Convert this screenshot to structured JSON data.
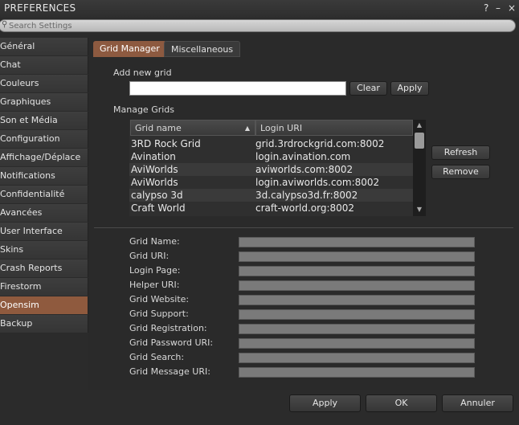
{
  "window": {
    "title": "PREFERENCES",
    "help_icon": "?",
    "minimize_icon": "–",
    "close_icon": "×"
  },
  "search": {
    "placeholder": "Search Settings"
  },
  "sidebar": {
    "items": [
      {
        "label": "Général"
      },
      {
        "label": "Chat"
      },
      {
        "label": "Couleurs"
      },
      {
        "label": "Graphiques"
      },
      {
        "label": "Son et Média"
      },
      {
        "label": "Configuration"
      },
      {
        "label": "Affichage/Déplace"
      },
      {
        "label": "Notifications"
      },
      {
        "label": "Confidentialité"
      },
      {
        "label": "Avancées"
      },
      {
        "label": "User Interface"
      },
      {
        "label": "Skins"
      },
      {
        "label": "Crash Reports"
      },
      {
        "label": "Firestorm"
      },
      {
        "label": "Opensim"
      },
      {
        "label": "Backup"
      }
    ],
    "active": "Opensim"
  },
  "tabs": [
    {
      "label": "Grid Manager"
    },
    {
      "label": "Miscellaneous"
    }
  ],
  "add_grid": {
    "label": "Add new grid",
    "value": "",
    "clear_label": "Clear",
    "apply_label": "Apply"
  },
  "manage": {
    "label": "Manage Grids",
    "columns": [
      "Grid name",
      "Login URI"
    ],
    "rows": [
      {
        "name": "3RD Rock Grid",
        "uri": "grid.3rdrockgrid.com:8002"
      },
      {
        "name": "Avination",
        "uri": "login.avination.com"
      },
      {
        "name": "AviWorlds",
        "uri": "aviworlds.com:8002"
      },
      {
        "name": "AviWorlds",
        "uri": "login.aviworlds.com:8002"
      },
      {
        "name": "calypso 3d",
        "uri": "3d.calypso3d.fr:8002"
      },
      {
        "name": "Craft World",
        "uri": "craft-world.org:8002"
      }
    ],
    "refresh_label": "Refresh",
    "remove_label": "Remove"
  },
  "details": [
    {
      "label": "Grid Name:"
    },
    {
      "label": "Grid URI:"
    },
    {
      "label": "Login Page:"
    },
    {
      "label": "Helper URI:"
    },
    {
      "label": "Grid Website:"
    },
    {
      "label": "Grid Support:"
    },
    {
      "label": "Grid Registration:"
    },
    {
      "label": "Grid Password URI:"
    },
    {
      "label": "Grid Search:"
    },
    {
      "label": "Grid Message URI:"
    }
  ],
  "footer": {
    "apply_label": "Apply",
    "ok_label": "OK",
    "cancel_label": "Annuler"
  },
  "colors": {
    "accent": "#8f5a3e",
    "background": "#2b2b2b"
  }
}
